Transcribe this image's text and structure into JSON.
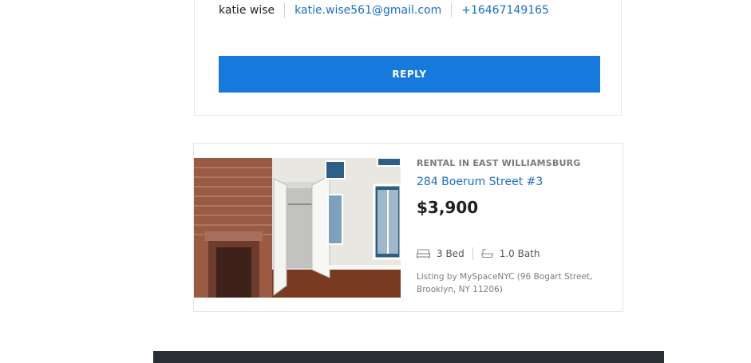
{
  "contact": {
    "name": "katie wise",
    "email": "katie.wise561@gmail.com",
    "phone": "+16467149165"
  },
  "reply_button": {
    "label": "REPLY"
  },
  "listing": {
    "type_label": "RENTAL IN EAST WILLIAMSBURG",
    "title": "284 Boerum Street #3",
    "price": "$3,900",
    "beds": "3 Bed",
    "baths": "1.0 Bath",
    "listed_by": "Listing by MySpaceNYC (96 Bogart Street, Brooklyn, NY 11206)"
  },
  "colors": {
    "accent": "#1879dd",
    "link": "#1a6fc4",
    "footer": "#2b2f35"
  },
  "icons": {
    "bed": "bed-icon",
    "bath": "bathtub-icon"
  }
}
